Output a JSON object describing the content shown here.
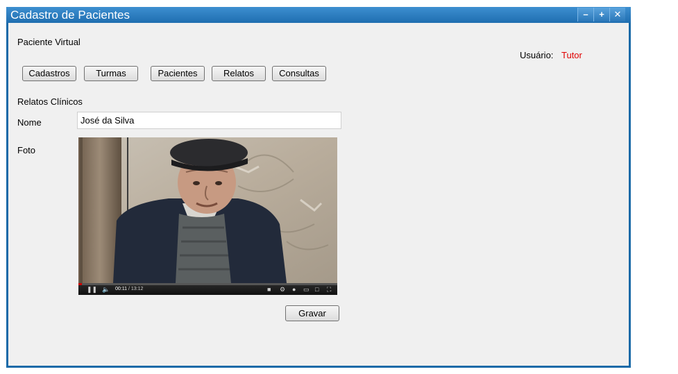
{
  "window": {
    "title": "Cadastro de Pacientes",
    "controls": {
      "minimize_icon": "minimize-icon",
      "maximize_icon": "maximize-icon",
      "close_icon": "close-icon"
    },
    "colors": {
      "titlebar": "#1f6eb0",
      "border": "#1a6aa8",
      "background": "#f0f0f0",
      "user_value": "#e00000"
    }
  },
  "header": {
    "app_name": "Paciente Virtual",
    "user_label": "Usuário:",
    "user_value": "Tutor"
  },
  "nav": {
    "buttons": [
      {
        "label": "Cadastros"
      },
      {
        "label": "Turmas"
      },
      {
        "label": "Pacientes"
      },
      {
        "label": "Relatos"
      },
      {
        "label": "Consultas"
      }
    ]
  },
  "form": {
    "section_title": "Relatos Clínicos",
    "name_label": "Nome",
    "name_value": "José da Silva",
    "photo_label": "Foto",
    "video": {
      "time_current": "00:11",
      "time_total": "13:12",
      "progress": 0.014,
      "play_pause_icon": "pause-icon",
      "volume_icon": "volume-icon",
      "captions_icon": "captions-icon",
      "settings_icon": "gear-icon",
      "info_icon": "info-icon",
      "theater_icon": "theater-mode-icon",
      "window_icon": "window-mode-icon",
      "fullscreen_icon": "fullscreen-icon"
    },
    "save_label": "Gravar"
  }
}
